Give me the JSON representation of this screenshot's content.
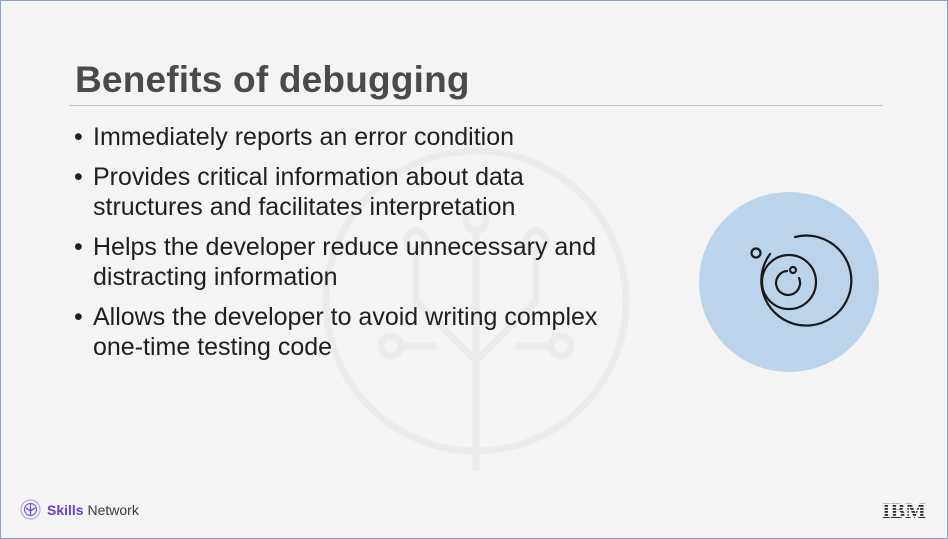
{
  "slide": {
    "title": "Benefits of debugging",
    "bullets": [
      {
        "line1": "Immediately reports an error condition",
        "line2": ""
      },
      {
        "line1": "Provides critical information about data",
        "line2": "structures and facilitates interpretation"
      },
      {
        "line1": "Helps the developer reduce unnecessary and",
        "line2": "distracting information"
      },
      {
        "line1": "Allows the developer to avoid writing complex",
        "line2": "one-time testing code"
      }
    ],
    "bullet_glyph": "•"
  },
  "illustration": {
    "icon": "orbit-target-icon",
    "circle_color": "#bcd3ec"
  },
  "footer": {
    "brand_bold": "Skills",
    "brand_rest": " Network",
    "company_logo": "IBM"
  }
}
